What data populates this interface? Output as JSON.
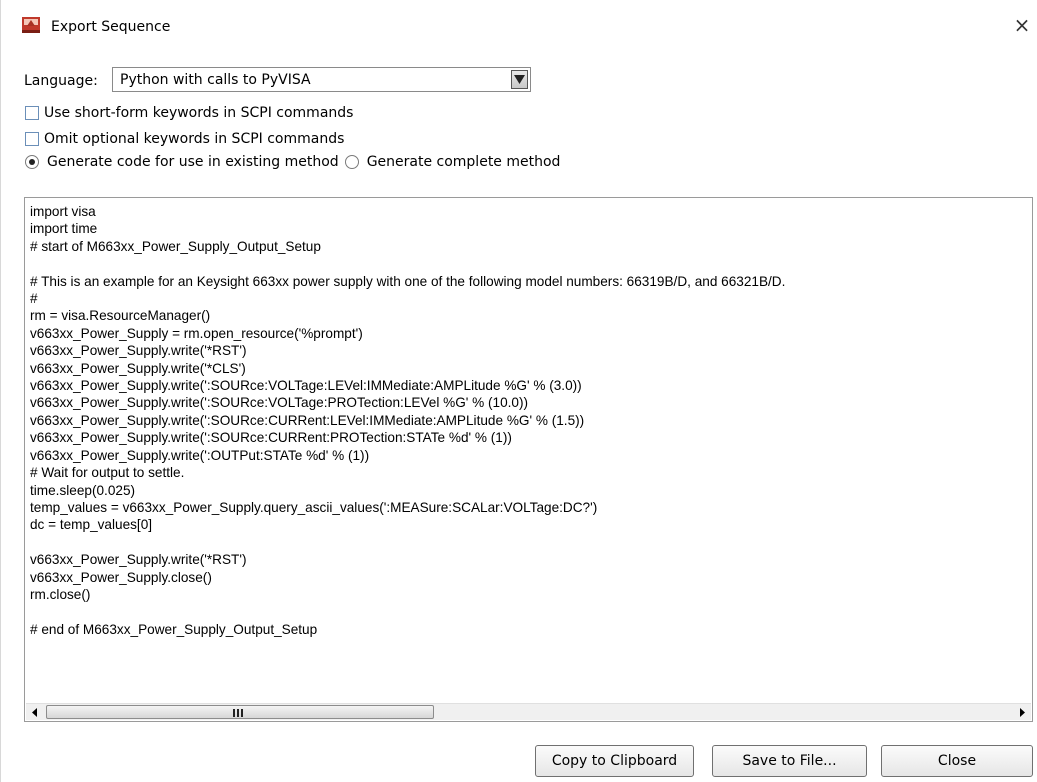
{
  "window": {
    "title": "Export Sequence",
    "close_symbol": "×",
    "icon": "app-logo-icon"
  },
  "language": {
    "label": "Language:",
    "selected": "Python with calls to PyVISA"
  },
  "options": {
    "short_form": {
      "label": "Use short-form keywords in SCPI commands",
      "checked": false
    },
    "omit_optional": {
      "label": "Omit optional keywords in SCPI commands",
      "checked": false
    }
  },
  "generate": {
    "existing": {
      "label": "Generate code for use in existing method",
      "selected": true
    },
    "complete": {
      "label": "Generate complete method",
      "selected": false
    }
  },
  "code": {
    "lines": [
      "import visa",
      "import time",
      "# start of M663xx_Power_Supply_Output_Setup",
      "",
      "# This is an example for an Keysight 663xx power supply with one of the following model numbers: 66319B/D, and 66321B/D.",
      "#",
      "rm = visa.ResourceManager()",
      "v663xx_Power_Supply = rm.open_resource('%prompt')",
      "v663xx_Power_Supply.write('*RST')",
      "v663xx_Power_Supply.write('*CLS')",
      "v663xx_Power_Supply.write(':SOURce:VOLTage:LEVel:IMMediate:AMPLitude %G' % (3.0))",
      "v663xx_Power_Supply.write(':SOURce:VOLTage:PROTection:LEVel %G' % (10.0))",
      "v663xx_Power_Supply.write(':SOURce:CURRent:LEVel:IMMediate:AMPLitude %G' % (1.5))",
      "v663xx_Power_Supply.write(':SOURce:CURRent:PROTection:STATe %d' % (1))",
      "v663xx_Power_Supply.write(':OUTPut:STATe %d' % (1))",
      "# Wait for output to settle.",
      "time.sleep(0.025)",
      "temp_values = v663xx_Power_Supply.query_ascii_values(':MEASure:SCALar:VOLTage:DC?')",
      "dc = temp_values[0]",
      "",
      "v663xx_Power_Supply.write('*RST')",
      "v663xx_Power_Supply.close()",
      "rm.close()",
      "",
      "# end of M663xx_Power_Supply_Output_Setup"
    ]
  },
  "buttons": {
    "copy": "Copy to Clipboard",
    "save": "Save to File...",
    "close": "Close"
  }
}
